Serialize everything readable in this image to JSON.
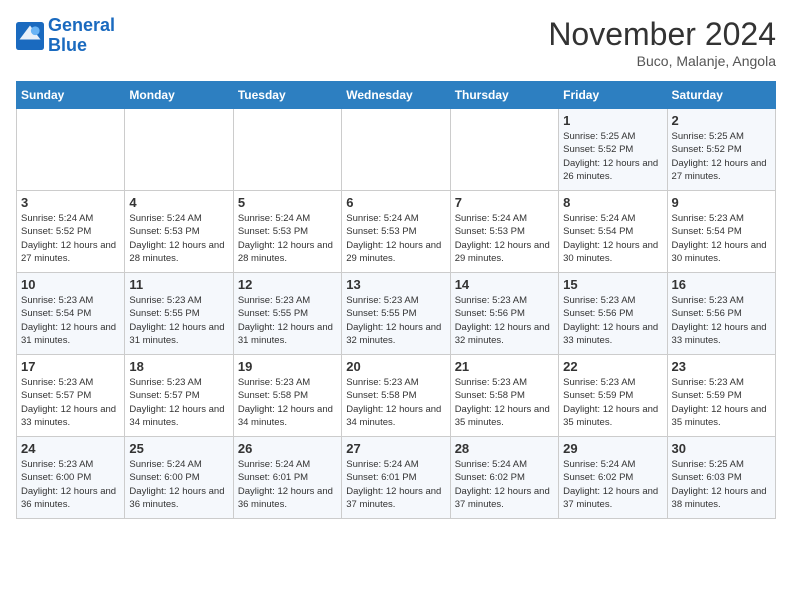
{
  "header": {
    "logo_line1": "General",
    "logo_line2": "Blue",
    "month_title": "November 2024",
    "location": "Buco, Malanje, Angola"
  },
  "days_of_week": [
    "Sunday",
    "Monday",
    "Tuesday",
    "Wednesday",
    "Thursday",
    "Friday",
    "Saturday"
  ],
  "weeks": [
    [
      {
        "day": "",
        "info": ""
      },
      {
        "day": "",
        "info": ""
      },
      {
        "day": "",
        "info": ""
      },
      {
        "day": "",
        "info": ""
      },
      {
        "day": "",
        "info": ""
      },
      {
        "day": "1",
        "info": "Sunrise: 5:25 AM\nSunset: 5:52 PM\nDaylight: 12 hours and 26 minutes."
      },
      {
        "day": "2",
        "info": "Sunrise: 5:25 AM\nSunset: 5:52 PM\nDaylight: 12 hours and 27 minutes."
      }
    ],
    [
      {
        "day": "3",
        "info": "Sunrise: 5:24 AM\nSunset: 5:52 PM\nDaylight: 12 hours and 27 minutes."
      },
      {
        "day": "4",
        "info": "Sunrise: 5:24 AM\nSunset: 5:53 PM\nDaylight: 12 hours and 28 minutes."
      },
      {
        "day": "5",
        "info": "Sunrise: 5:24 AM\nSunset: 5:53 PM\nDaylight: 12 hours and 28 minutes."
      },
      {
        "day": "6",
        "info": "Sunrise: 5:24 AM\nSunset: 5:53 PM\nDaylight: 12 hours and 29 minutes."
      },
      {
        "day": "7",
        "info": "Sunrise: 5:24 AM\nSunset: 5:53 PM\nDaylight: 12 hours and 29 minutes."
      },
      {
        "day": "8",
        "info": "Sunrise: 5:24 AM\nSunset: 5:54 PM\nDaylight: 12 hours and 30 minutes."
      },
      {
        "day": "9",
        "info": "Sunrise: 5:23 AM\nSunset: 5:54 PM\nDaylight: 12 hours and 30 minutes."
      }
    ],
    [
      {
        "day": "10",
        "info": "Sunrise: 5:23 AM\nSunset: 5:54 PM\nDaylight: 12 hours and 31 minutes."
      },
      {
        "day": "11",
        "info": "Sunrise: 5:23 AM\nSunset: 5:55 PM\nDaylight: 12 hours and 31 minutes."
      },
      {
        "day": "12",
        "info": "Sunrise: 5:23 AM\nSunset: 5:55 PM\nDaylight: 12 hours and 31 minutes."
      },
      {
        "day": "13",
        "info": "Sunrise: 5:23 AM\nSunset: 5:55 PM\nDaylight: 12 hours and 32 minutes."
      },
      {
        "day": "14",
        "info": "Sunrise: 5:23 AM\nSunset: 5:56 PM\nDaylight: 12 hours and 32 minutes."
      },
      {
        "day": "15",
        "info": "Sunrise: 5:23 AM\nSunset: 5:56 PM\nDaylight: 12 hours and 33 minutes."
      },
      {
        "day": "16",
        "info": "Sunrise: 5:23 AM\nSunset: 5:56 PM\nDaylight: 12 hours and 33 minutes."
      }
    ],
    [
      {
        "day": "17",
        "info": "Sunrise: 5:23 AM\nSunset: 5:57 PM\nDaylight: 12 hours and 33 minutes."
      },
      {
        "day": "18",
        "info": "Sunrise: 5:23 AM\nSunset: 5:57 PM\nDaylight: 12 hours and 34 minutes."
      },
      {
        "day": "19",
        "info": "Sunrise: 5:23 AM\nSunset: 5:58 PM\nDaylight: 12 hours and 34 minutes."
      },
      {
        "day": "20",
        "info": "Sunrise: 5:23 AM\nSunset: 5:58 PM\nDaylight: 12 hours and 34 minutes."
      },
      {
        "day": "21",
        "info": "Sunrise: 5:23 AM\nSunset: 5:58 PM\nDaylight: 12 hours and 35 minutes."
      },
      {
        "day": "22",
        "info": "Sunrise: 5:23 AM\nSunset: 5:59 PM\nDaylight: 12 hours and 35 minutes."
      },
      {
        "day": "23",
        "info": "Sunrise: 5:23 AM\nSunset: 5:59 PM\nDaylight: 12 hours and 35 minutes."
      }
    ],
    [
      {
        "day": "24",
        "info": "Sunrise: 5:23 AM\nSunset: 6:00 PM\nDaylight: 12 hours and 36 minutes."
      },
      {
        "day": "25",
        "info": "Sunrise: 5:24 AM\nSunset: 6:00 PM\nDaylight: 12 hours and 36 minutes."
      },
      {
        "day": "26",
        "info": "Sunrise: 5:24 AM\nSunset: 6:01 PM\nDaylight: 12 hours and 36 minutes."
      },
      {
        "day": "27",
        "info": "Sunrise: 5:24 AM\nSunset: 6:01 PM\nDaylight: 12 hours and 37 minutes."
      },
      {
        "day": "28",
        "info": "Sunrise: 5:24 AM\nSunset: 6:02 PM\nDaylight: 12 hours and 37 minutes."
      },
      {
        "day": "29",
        "info": "Sunrise: 5:24 AM\nSunset: 6:02 PM\nDaylight: 12 hours and 37 minutes."
      },
      {
        "day": "30",
        "info": "Sunrise: 5:25 AM\nSunset: 6:03 PM\nDaylight: 12 hours and 38 minutes."
      }
    ]
  ]
}
